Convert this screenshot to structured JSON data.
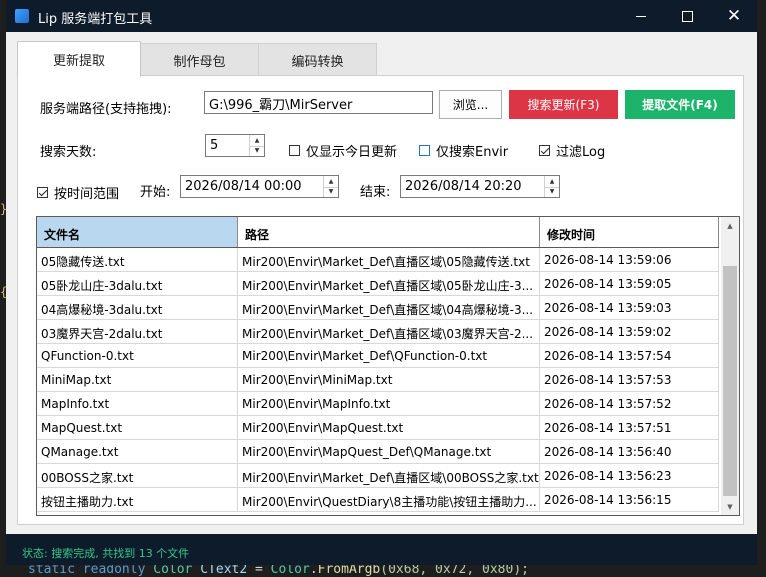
{
  "window": {
    "title": "Lip 服务端打包工具"
  },
  "tabs": [
    {
      "label": "更新提取",
      "active": true
    },
    {
      "label": "制作母包",
      "active": false
    },
    {
      "label": "编码转换",
      "active": false
    }
  ],
  "path_row": {
    "label": "服务端路径(支持拖拽):",
    "value": "G:\\996_霸刀\\MirServer",
    "browse_label": "浏览...",
    "search_label": "搜索更新(F3)",
    "extract_label": "提取文件(F4)"
  },
  "days_row": {
    "label": "搜索天数:",
    "value": "5",
    "today_only": {
      "label": "仅显示今日更新",
      "checked": false
    },
    "envir_only": {
      "label": "仅搜索Envir",
      "checked": false
    },
    "filter_log": {
      "label": "过滤Log",
      "checked": true
    }
  },
  "time_row": {
    "by_range": {
      "label": "按时间范围",
      "checked": true
    },
    "start_label": "开始:",
    "start_value": "2026/08/14 00:00",
    "end_label": "结束:",
    "end_value": "2026/08/14 20:20"
  },
  "table": {
    "columns": [
      "文件名",
      "路径",
      "修改时间"
    ],
    "rows": [
      {
        "name": "05隐藏传送.txt",
        "path": "Mir200\\Envir\\Market_Def\\直播区域\\05隐藏传送.txt",
        "time": "2026-08-14 13:59:06"
      },
      {
        "name": "05卧龙山庄-3dalu.txt",
        "path": "Mir200\\Envir\\Market_Def\\直播区域\\05卧龙山庄-3...",
        "time": "2026-08-14 13:59:05"
      },
      {
        "name": "04高爆秘境-3dalu.txt",
        "path": "Mir200\\Envir\\Market_Def\\直播区域\\04高爆秘境-3...",
        "time": "2026-08-14 13:59:03"
      },
      {
        "name": "03魔界天宫-2dalu.txt",
        "path": "Mir200\\Envir\\Market_Def\\直播区域\\03魔界天宫-2...",
        "time": "2026-08-14 13:59:02"
      },
      {
        "name": "QFunction-0.txt",
        "path": "Mir200\\Envir\\Market_Def\\QFunction-0.txt",
        "time": "2026-08-14 13:57:54"
      },
      {
        "name": "MiniMap.txt",
        "path": "Mir200\\Envir\\MiniMap.txt",
        "time": "2026-08-14 13:57:53"
      },
      {
        "name": "MapInfo.txt",
        "path": "Mir200\\Envir\\MapInfo.txt",
        "time": "2026-08-14 13:57:52"
      },
      {
        "name": "MapQuest.txt",
        "path": "Mir200\\Envir\\MapQuest.txt",
        "time": "2026-08-14 13:57:51"
      },
      {
        "name": "QManage.txt",
        "path": "Mir200\\Envir\\MapQuest_Def\\QManage.txt",
        "time": "2026-08-14 13:56:40"
      },
      {
        "name": "00BOSS之家.txt",
        "path": "Mir200\\Envir\\Market_Def\\直播区域\\00BOSS之家.txt",
        "time": "2026-08-14 13:56:23"
      },
      {
        "name": "按钮主播助力.txt",
        "path": "Mir200\\Envir\\QuestDiary\\8主播功能\\按钮主播助力...",
        "time": "2026-08-14 13:56:15"
      }
    ]
  },
  "status": {
    "text": "状态: 搜索完成, 共找到 13 个文件"
  },
  "background_code": {
    "kw1": "static",
    "kw2": "readonly",
    "type": "Color",
    "name": "CText2",
    "eq": "=",
    "cls": "Color",
    "fn": "FromArgb",
    "args": "(0x68, 0x72, 0x80);"
  },
  "colors": {
    "accent_red": "#dc3545",
    "accent_green": "#1cb36a",
    "status_green": "#35c98a",
    "titlebar": "#0d1b2a",
    "header_selected": "#b9d7ee"
  }
}
